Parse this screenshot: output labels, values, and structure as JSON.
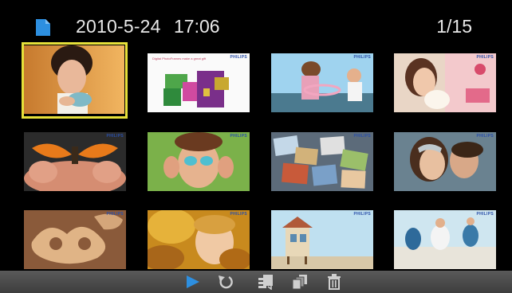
{
  "header": {
    "file_icon": "file-icon",
    "date": "2010-5-24",
    "time": "17:06",
    "counter": "1/15"
  },
  "thumbnails": [
    {
      "subject": "woman with cup",
      "selected": true
    },
    {
      "subject": "gift boxes",
      "caption": "Digital PhotoFrames make a great gift"
    },
    {
      "subject": "girls in summer"
    },
    {
      "subject": "woman with puppy"
    },
    {
      "subject": "butterfly on hands"
    },
    {
      "subject": "girl with face paint"
    },
    {
      "subject": "photo collage"
    },
    {
      "subject": "couple kissing"
    },
    {
      "subject": "pretzel cookies"
    },
    {
      "subject": "boy in autumn leaves"
    },
    {
      "subject": "beach house"
    },
    {
      "subject": "family on beach"
    }
  ],
  "brand_label": "PHILIPS",
  "toolbar": {
    "items": [
      "play-icon",
      "rotate-icon",
      "copy-icon",
      "stack-icon",
      "delete-icon"
    ]
  },
  "colors": {
    "background": "#000000",
    "selection": "#e6e03a",
    "accent": "#2d8fe0",
    "toolbar": "#4a4a4a"
  }
}
